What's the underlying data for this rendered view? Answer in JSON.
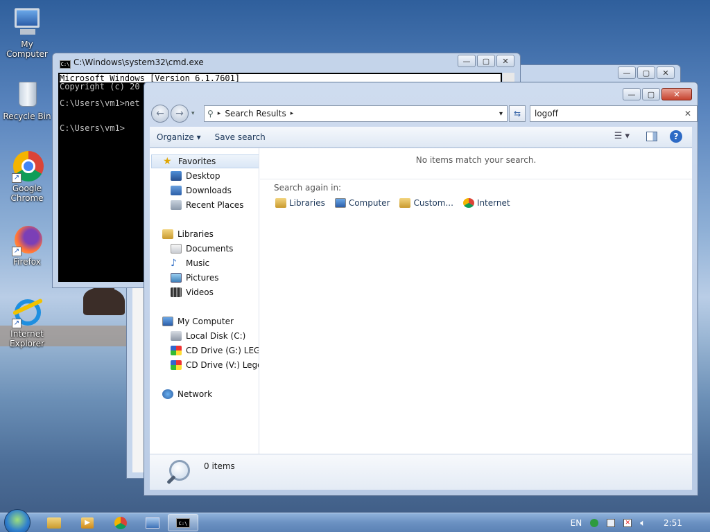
{
  "desktop": {
    "icons": [
      {
        "label": "My Computer",
        "icon": "computer-icon"
      },
      {
        "label": "Recycle Bin",
        "icon": "recycle-bin-icon"
      },
      {
        "label": "Google Chrome",
        "icon": "chrome-icon"
      },
      {
        "label": "Firefox",
        "icon": "firefox-icon"
      },
      {
        "label": "Internet Explorer",
        "icon": "ie-icon"
      }
    ]
  },
  "cmd": {
    "title": "C:\\Windows\\system32\\cmd.exe",
    "lines": [
      "Microsoft Windows [Version 6.1.7601]",
      "Copyright (c) 20",
      "",
      "C:\\Users\\vm1>net",
      "",
      "",
      "C:\\Users\\vm1>"
    ]
  },
  "explorer": {
    "address": "Search Results",
    "search_value": "logoff",
    "toolbar": {
      "organize": "Organize",
      "save_search": "Save search"
    },
    "nav": {
      "favorites": "Favorites",
      "desktop": "Desktop",
      "downloads": "Downloads",
      "recent": "Recent Places",
      "libraries": "Libraries",
      "documents": "Documents",
      "music": "Music",
      "pictures": "Pictures",
      "videos": "Videos",
      "computer": "My Computer",
      "disk_c": "Local Disk (C:)",
      "cd_g": "CD Drive (G:) LEGO_I",
      "cd_v": "CD Drive (V:) Lego_is",
      "network": "Network"
    },
    "content": {
      "no_items": "No items match your search.",
      "search_again": "Search again in:",
      "links": [
        "Libraries",
        "Computer",
        "Custom...",
        "Internet"
      ]
    },
    "details": {
      "count": "0 items"
    }
  },
  "taskbar": {
    "lang": "EN",
    "time": "2:51"
  }
}
